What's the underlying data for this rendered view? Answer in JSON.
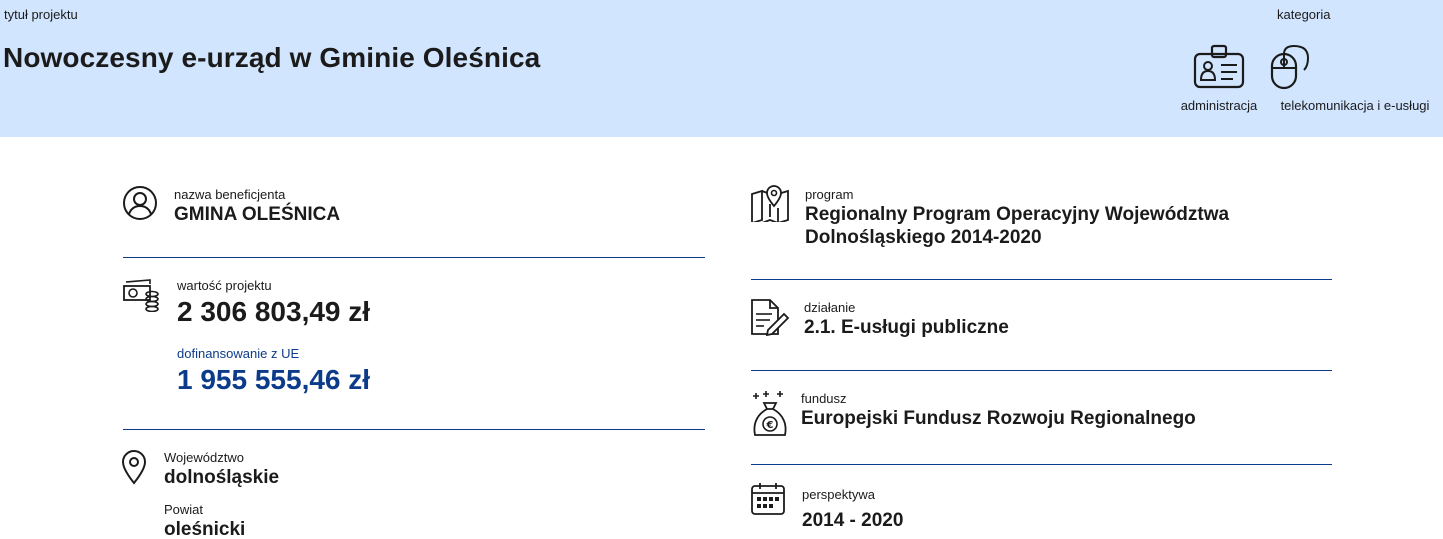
{
  "header": {
    "title_label": "tytuł projektu",
    "title": "Nowoczesny e-urząd w Gminie Oleśnica",
    "category_label": "kategoria",
    "categories": [
      {
        "label": "administracja",
        "icon": "id-card-icon"
      },
      {
        "label": "telekomunikacja i e-usługi",
        "icon": "computer-mouse-icon"
      }
    ]
  },
  "left": {
    "beneficiary": {
      "label": "nazwa beneficjenta",
      "value": "GMINA OLEŚNICA",
      "icon": "user-circle-icon"
    },
    "value": {
      "label": "wartość projektu",
      "value": "2 306 803,49 zł",
      "icon": "money-coins-icon"
    },
    "cofinancing": {
      "label": "dofinansowanie z UE",
      "value": "1 955 555,46 zł"
    },
    "location": {
      "icon": "location-pin-icon",
      "voivodeship_label": "Województwo",
      "voivodeship": "dolnośląskie",
      "county_label": "Powiat",
      "county": "oleśnicki"
    }
  },
  "right": {
    "program": {
      "label": "program",
      "value_line1": "Regionalny Program Operacyjny Województwa",
      "value_line2": "Dolnośląskiego 2014-2020",
      "icon": "map-pin-icon"
    },
    "action": {
      "label": "działanie",
      "value": "2.1. E-usługi publiczne",
      "icon": "document-pen-icon"
    },
    "fund": {
      "label": "fundusz",
      "value": "Europejski Fundusz Rozwoju Regionalnego",
      "icon": "euro-bag-icon"
    },
    "period": {
      "label": "perspektywa",
      "value": "2014 - 2020",
      "icon": "calendar-icon"
    }
  },
  "colors": {
    "header_bg": "#d1e5ff",
    "accent_blue": "#0c3b8a",
    "text": "#1b1b1b"
  }
}
